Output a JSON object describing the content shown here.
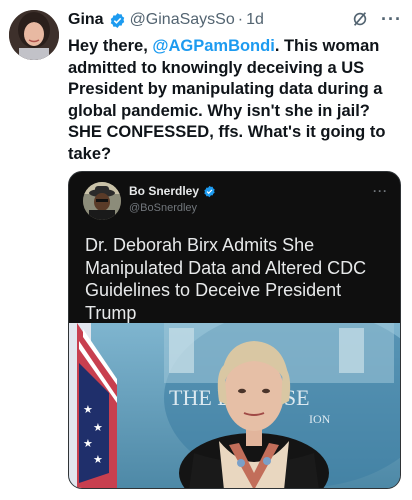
{
  "tweet": {
    "author_name": "Gina",
    "handle": "@GinaSaysSo",
    "separator": "·",
    "time": "1d",
    "text_before": "Hey there, ",
    "mention": "@AGPamBondi",
    "text_after": ". This woman admitted to knowingly deceiving a US President by manipulating data during a global pandemic. Why isn't she in jail? SHE CONFESSED, ffs. What's it going to take?",
    "verified_color": "#1d9bf0"
  },
  "quoted_tweet": {
    "author_name": "Bo Snerdley",
    "handle": "@BoSnerdley",
    "text": "Dr. Deborah Birx Admits She Manipulated Data and Altered CDC Guidelines to Deceive President Trump",
    "image_sign_text": "THE  E HOUSE",
    "image_sign_sub": "ION"
  },
  "icons": {
    "verified": "verified-badge-icon",
    "grok": "grok-icon",
    "more": "more-icon"
  },
  "colors": {
    "accent": "#1d9bf0",
    "quote_bg": "#0f0f0f"
  }
}
